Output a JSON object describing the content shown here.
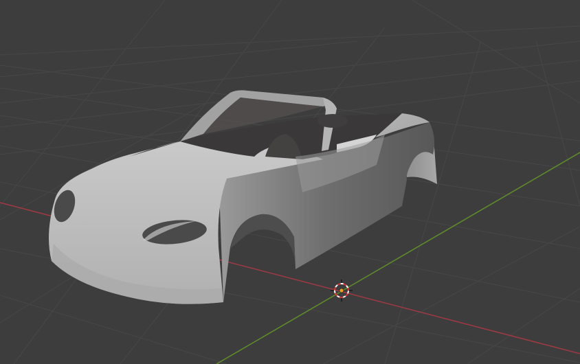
{
  "viewport": {
    "background": "#3d3d3d",
    "grid_color": "#484848",
    "x_axis_color": "#9b3a44",
    "y_axis_color": "#5e8a2c",
    "cursor_color": "#e8e8e8",
    "origin_color": "#f0a020"
  },
  "object": {
    "type": "car-body-mesh",
    "shading": "solid",
    "body_color": "#bdbdbd",
    "shadow_color": "#4a4a4a",
    "interior_color": "#3a3838"
  }
}
